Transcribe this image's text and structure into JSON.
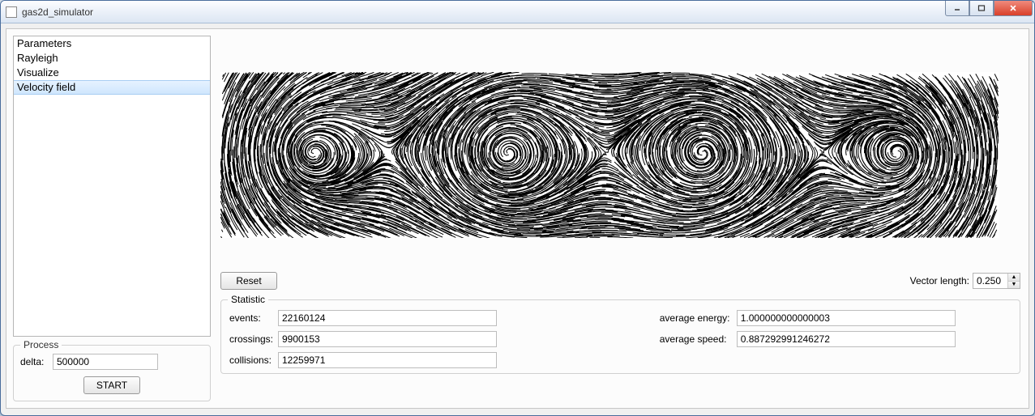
{
  "window": {
    "title": "gas2d_simulator"
  },
  "sidebar": {
    "items": [
      {
        "label": "Parameters",
        "selected": false
      },
      {
        "label": "Rayleigh",
        "selected": false
      },
      {
        "label": "Visualize",
        "selected": false
      },
      {
        "label": "Velocity field",
        "selected": true
      }
    ]
  },
  "process": {
    "legend": "Process",
    "delta_label": "delta:",
    "delta_value": "500000",
    "start_label": "START"
  },
  "controls": {
    "reset_label": "Reset",
    "vector_length_label": "Vector length:",
    "vector_length_value": "0.250"
  },
  "statistic": {
    "legend": "Statistic",
    "events_label": "events:",
    "events_value": "22160124",
    "crossings_label": "crossings:",
    "crossings_value": "9900153",
    "collisions_label": "collisions:",
    "collisions_value": "12259971",
    "avg_energy_label": "average energy:",
    "avg_energy_value": "1.000000000000003",
    "avg_speed_label": "average speed:",
    "avg_speed_value": "0.887292991246272"
  }
}
